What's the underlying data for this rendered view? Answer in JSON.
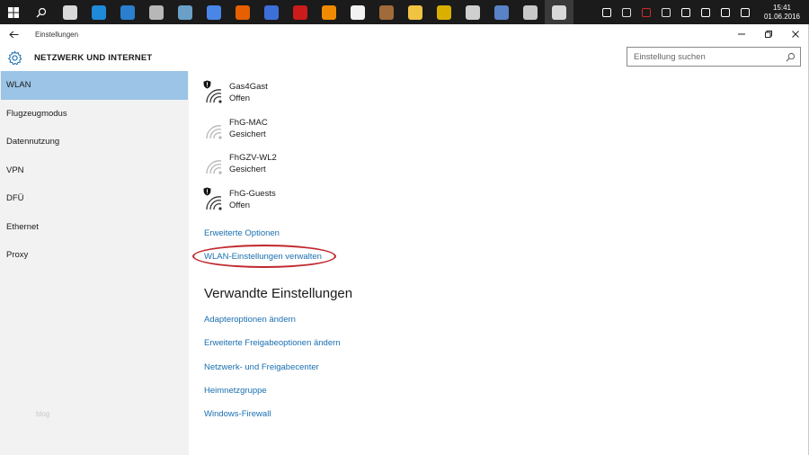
{
  "taskbar": {
    "apps": [
      {
        "icon": "file-explorer-icon",
        "color": "#d9d9d9"
      },
      {
        "icon": "teamviewer-icon",
        "color": "#1f8ad8"
      },
      {
        "icon": "monitor-app-icon",
        "color": "#2a7fcf"
      },
      {
        "icon": "virtualbox-icon",
        "color": "#b7b7b7"
      },
      {
        "icon": "tool-app-icon",
        "color": "#6aa0c8"
      },
      {
        "icon": "chrome-icon",
        "color": "#4a86e8"
      },
      {
        "icon": "firefox-icon",
        "color": "#e66000"
      },
      {
        "icon": "app-blue-icon",
        "color": "#3d6fd8"
      },
      {
        "icon": "opera-icon",
        "color": "#cc1b1b"
      },
      {
        "icon": "vlc-icon",
        "color": "#f08a00"
      },
      {
        "icon": "document-icon",
        "color": "#f2f2f2"
      },
      {
        "icon": "library-icon",
        "color": "#a06a3a"
      },
      {
        "icon": "folder-icon",
        "color": "#f0c341"
      },
      {
        "icon": "nero-icon",
        "color": "#d9b000"
      },
      {
        "icon": "blank-app-icon",
        "color": "#cfcfcf"
      },
      {
        "icon": "shield-app-icon",
        "color": "#5a82c8"
      },
      {
        "icon": "steam-icon",
        "color": "#c8c8c8"
      },
      {
        "icon": "settings-icon",
        "color": "#d9d9d9"
      }
    ],
    "tray": [
      {
        "icon": "chevron-up-icon",
        "color": "#ffffff"
      },
      {
        "icon": "network-tray-icon",
        "color": "#dddddd"
      },
      {
        "icon": "pdf-tray-icon",
        "color": "#cc2b2b"
      },
      {
        "icon": "tray-app-icon",
        "color": "#dddddd"
      },
      {
        "icon": "wifi-tray-icon",
        "color": "#ffffff"
      },
      {
        "icon": "volume-icon",
        "color": "#ffffff"
      },
      {
        "icon": "action-center-icon",
        "color": "#ffffff"
      },
      {
        "icon": "keyboard-icon",
        "color": "#ffffff"
      }
    ],
    "time": "15:41",
    "date": "01.06.2016"
  },
  "window": {
    "title": "Einstellungen"
  },
  "header": {
    "title": "NETZWERK UND INTERNET",
    "search_placeholder": "Einstellung suchen"
  },
  "sidebar": {
    "items": [
      {
        "label": "WLAN",
        "selected": true
      },
      {
        "label": "Flugzeugmodus"
      },
      {
        "label": "Datennutzung"
      },
      {
        "label": "VPN"
      },
      {
        "label": "DFÜ"
      },
      {
        "label": "Ethernet"
      },
      {
        "label": "Proxy"
      }
    ],
    "footer": "blog"
  },
  "networks": [
    {
      "name": "Gas4Gast",
      "status": "Offen",
      "shield": true
    },
    {
      "name": "FhG-MAC",
      "status": "Gesichert",
      "shield": false
    },
    {
      "name": "FhGZV-WL2",
      "status": "Gesichert",
      "shield": false
    },
    {
      "name": "FhG-Guests",
      "status": "Offen",
      "shield": true
    }
  ],
  "links": {
    "advanced": "Erweiterte Optionen",
    "manage": "WLAN-Einstellungen verwalten"
  },
  "related": {
    "title": "Verwandte Einstellungen",
    "items": [
      "Adapteroptionen ändern",
      "Erweiterte Freigabeoptionen ändern",
      "Netzwerk- und Freigabecenter",
      "Heimnetzgruppe",
      "Windows-Firewall"
    ]
  },
  "colors": {
    "accent": "#9bc4e6",
    "link": "#1a6fb0",
    "highlight": "#c0272d"
  }
}
